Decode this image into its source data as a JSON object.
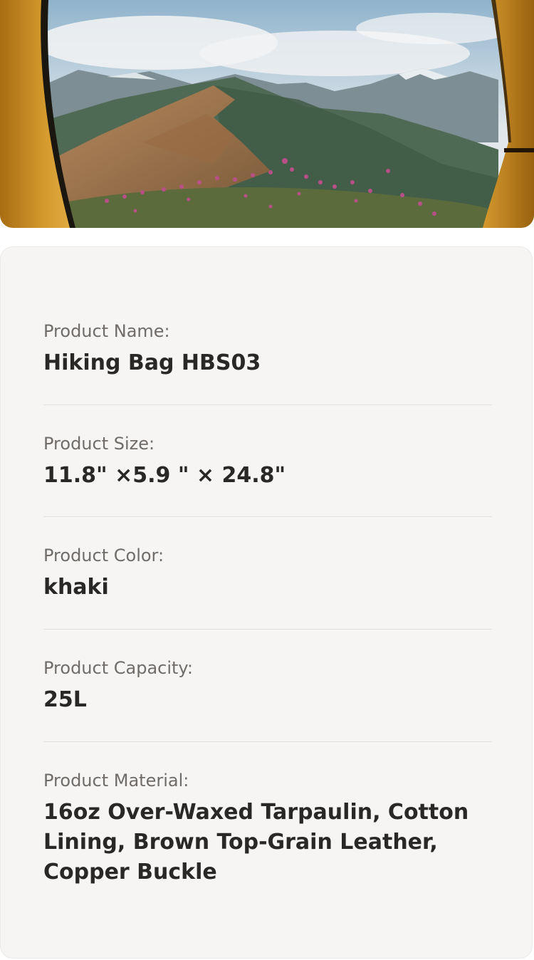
{
  "hero": {
    "icon": "tent-mountain-view-photo",
    "colors": {
      "sky": "#b9cbd8",
      "tent": "#c78a21",
      "mountain": "#4f6a54"
    }
  },
  "specs": [
    {
      "label": "Product Name:",
      "value": "Hiking Bag HBS03"
    },
    {
      "label": "Product Size:",
      "value": "11.8\" ×5.9 \" × 24.8\""
    },
    {
      "label": "Product Color:",
      "value": "khaki"
    },
    {
      "label": "Product Capacity:",
      "value": "25L"
    },
    {
      "label": "Product Material:",
      "value": "16oz Over-Waxed Tarpaulin, Cotton Lining, Brown Top-Grain Leather, Copper Buckle"
    }
  ]
}
